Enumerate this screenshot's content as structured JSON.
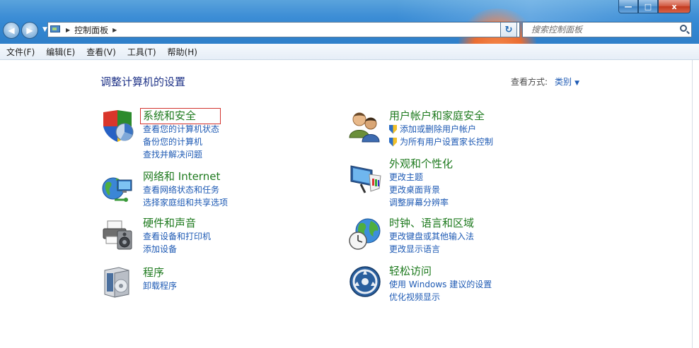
{
  "window": {
    "minimize_glyph": "—",
    "maximize_glyph": "□",
    "close_glyph": "x"
  },
  "address": {
    "crumb": "控制面板",
    "back_glyph": "◀",
    "forward_glyph": "▶",
    "refresh_glyph": "↻"
  },
  "search": {
    "placeholder": "搜索控制面板"
  },
  "menu": [
    "文件(F)",
    "编辑(E)",
    "查看(V)",
    "工具(T)",
    "帮助(H)"
  ],
  "page": {
    "title": "调整计算机的设置",
    "view_by_label": "查看方式:",
    "view_by_value": "类别"
  },
  "categories_left": [
    {
      "title": "系统和安全",
      "icon": "shield-chart-icon",
      "links": [
        {
          "text": "查看您的计算机状态"
        },
        {
          "text": "备份您的计算机"
        },
        {
          "text": "查找并解决问题"
        }
      ]
    },
    {
      "title": "网络和 Internet",
      "icon": "globe-network-icon",
      "links": [
        {
          "text": "查看网络状态和任务"
        },
        {
          "text": "选择家庭组和共享选项"
        }
      ]
    },
    {
      "title": "硬件和声音",
      "icon": "printer-speaker-icon",
      "links": [
        {
          "text": "查看设备和打印机"
        },
        {
          "text": "添加设备"
        }
      ]
    },
    {
      "title": "程序",
      "icon": "program-box-icon",
      "links": [
        {
          "text": "卸载程序"
        }
      ]
    }
  ],
  "categories_right": [
    {
      "title": "用户帐户和家庭安全",
      "icon": "users-icon",
      "links": [
        {
          "text": "添加或删除用户帐户",
          "shield": true
        },
        {
          "text": "为所有用户设置家长控制",
          "shield": true
        }
      ]
    },
    {
      "title": "外观和个性化",
      "icon": "monitor-brush-icon",
      "links": [
        {
          "text": "更改主题"
        },
        {
          "text": "更改桌面背景"
        },
        {
          "text": "调整屏幕分辨率"
        }
      ]
    },
    {
      "title": "时钟、语言和区域",
      "icon": "clock-globe-icon",
      "links": [
        {
          "text": "更改键盘或其他输入法"
        },
        {
          "text": "更改显示语言"
        }
      ]
    },
    {
      "title": "轻松访问",
      "icon": "ease-of-access-icon",
      "links": [
        {
          "text": "使用 Windows 建议的设置"
        },
        {
          "text": "优化视频显示"
        }
      ]
    }
  ]
}
